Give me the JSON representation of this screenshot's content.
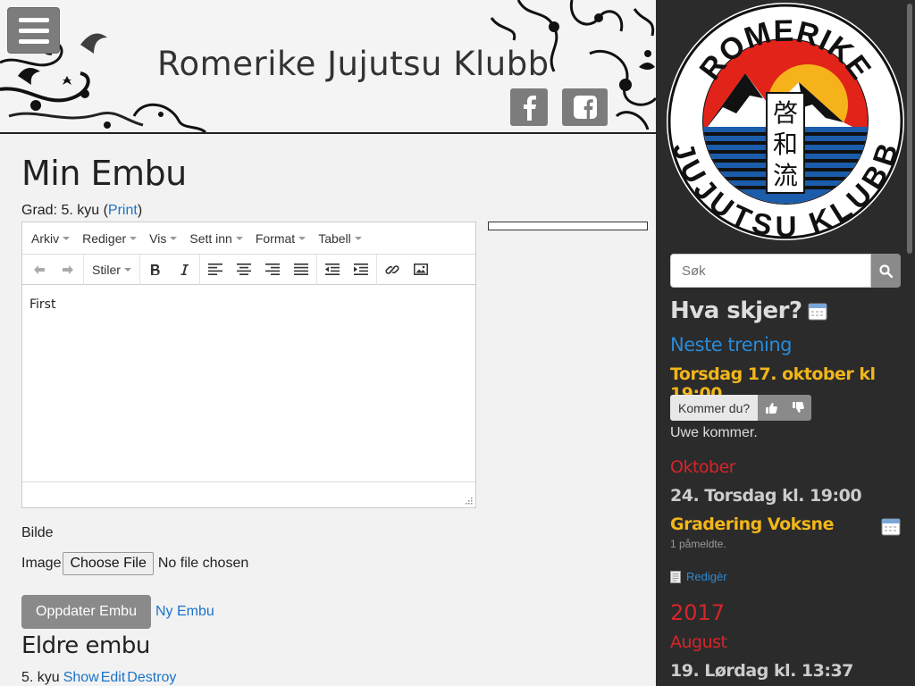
{
  "header": {
    "site_title": "Romerike Jujutsu Klubb",
    "menu_icon": "hamburger-icon",
    "social": [
      {
        "name": "facebook-icon",
        "glyph": "f"
      },
      {
        "name": "facebook-square-icon",
        "glyph": "f"
      }
    ]
  },
  "main": {
    "title": "Min Embu",
    "grade_prefix": "Grad: 5. kyu (",
    "print_link": "Print",
    "grade_suffix": ")",
    "editor": {
      "menubar": [
        "Arkiv",
        "Rediger",
        "Vis",
        "Sett inn",
        "Format",
        "Tabell"
      ],
      "styles_label": "Stiler",
      "content": "First"
    },
    "bilde_label": "Bilde",
    "image_label": "Image",
    "file_button": "Choose File",
    "file_status": "No file chosen",
    "update_button": "Oppdater Embu",
    "new_embu_link": "Ny Embu",
    "older_title": "Eldre embu",
    "older_row": {
      "grade": "5. kyu",
      "show": "Show",
      "edit": "Edit",
      "destroy": "Destroy"
    }
  },
  "sidebar": {
    "logo": {
      "top_text": "ROMERIKE",
      "bottom_text": "JUJUTSU KLUBB",
      "kanji": [
        "啓",
        "和",
        "流"
      ]
    },
    "search_placeholder": "Søk",
    "whats_on": "Hva skjer?",
    "next_training": "Neste trening",
    "training_date": "Torsdag 17. oktober kl 19:00",
    "rsvp_label": "Kommer du?",
    "attending": "Uwe kommer.",
    "month1": "Oktober",
    "event1_date": "24. Torsdag kl. 19:00",
    "event1_title": "Gradering Voksne",
    "event1_count": "1 påmeldte.",
    "edit_link": "Redigèr",
    "year": "2017",
    "month2": "August",
    "event2_date": "19. Lørdag kl. 13:37"
  },
  "colors": {
    "accent_blue": "#2a8ad6",
    "accent_yellow": "#f2b61b",
    "accent_red": "#d6252a",
    "sidebar_bg": "#2b2b2b",
    "button_gray": "#8a8a8a"
  }
}
